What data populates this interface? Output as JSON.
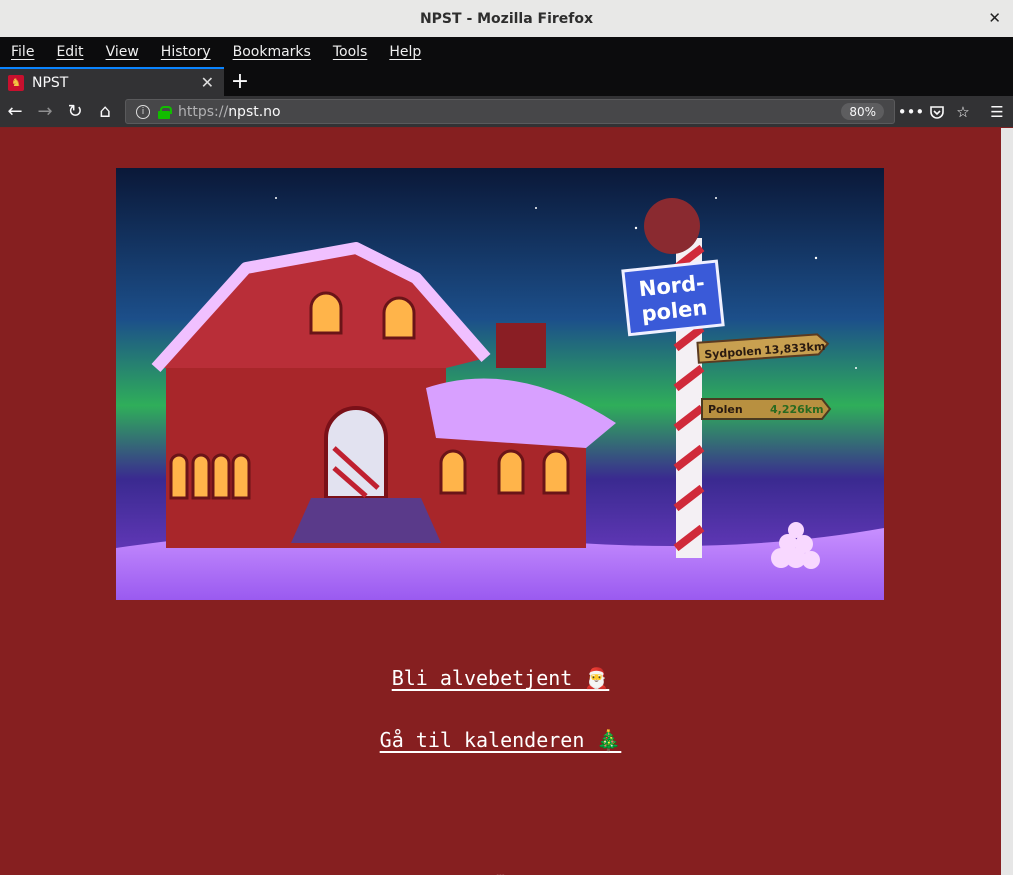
{
  "window": {
    "title": "NPST - Mozilla Firefox"
  },
  "menu": [
    "File",
    "Edit",
    "View",
    "History",
    "Bookmarks",
    "Tools",
    "Help"
  ],
  "tab": {
    "title": "NPST"
  },
  "url": {
    "scheme": "https://",
    "host": "npst.no",
    "zoom": "80%"
  },
  "hero": {
    "sign_main": [
      "Nord-",
      "polen"
    ],
    "sign_arrow1": {
      "place": "Sydpolen",
      "distance": "13,833km"
    },
    "sign_arrow2": {
      "place": "Polen",
      "distance": "4,226km"
    }
  },
  "links": [
    {
      "label": "Bli alvebetjent 🎅"
    },
    {
      "label": "Gå til kalenderen 🎄"
    }
  ],
  "footer_text": "…"
}
